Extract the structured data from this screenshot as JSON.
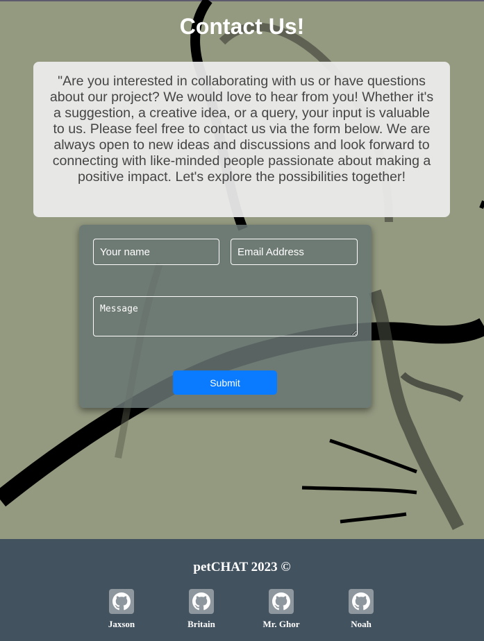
{
  "page": {
    "title": "Contact Us!",
    "intro": "\"Are you interested in collaborating with us or have questions about our project? We would love to hear from you! Whether it's a suggestion, a creative idea, or a query, your input is valuable to us. Please feel free to contact us via the form below. We are always open to new ideas and discussions and look forward to connecting with like-minded people passionate about making a positive impact. Let's explore the possibilities together!"
  },
  "form": {
    "name_placeholder": "Your name",
    "email_placeholder": "Email Address",
    "message_placeholder": "Message",
    "submit_label": "Submit"
  },
  "footer": {
    "title": "petCHAT 2023 ©",
    "members": [
      {
        "name": "Jaxson",
        "icon": "github-icon"
      },
      {
        "name": "Britain",
        "icon": "github-icon"
      },
      {
        "name": "Mr. Ghor",
        "icon": "github-icon"
      },
      {
        "name": "Noah",
        "icon": "github-icon"
      }
    ]
  },
  "colors": {
    "background": "#949a80",
    "footer": "#42525f",
    "submit": "#0a7bff",
    "form": "#687472"
  }
}
